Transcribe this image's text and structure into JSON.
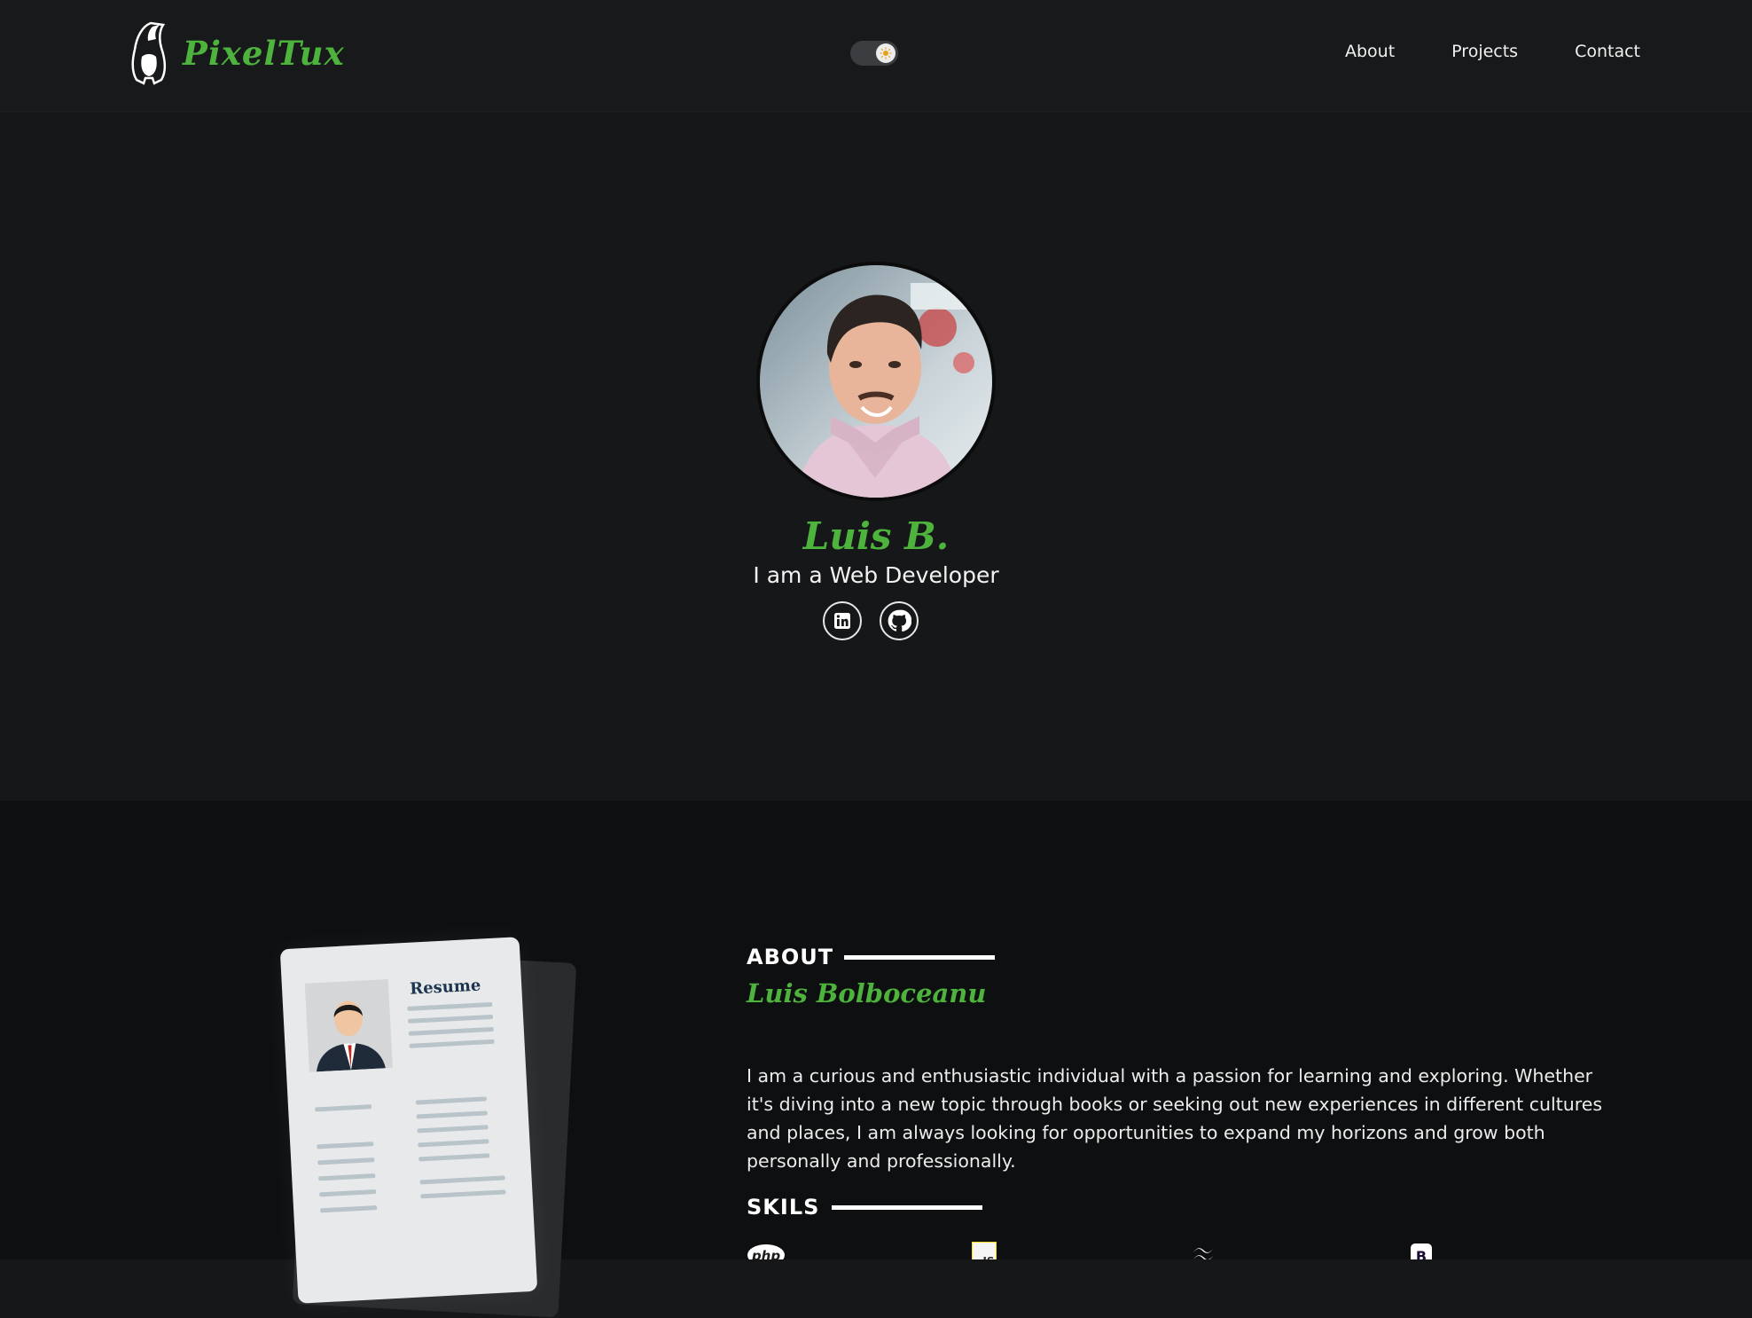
{
  "brand": {
    "name": "PixelTux",
    "color": "#4db33d"
  },
  "theme_toggle": {
    "state": "light-icon",
    "icon": "sun-icon"
  },
  "nav": {
    "items": [
      {
        "label": "About"
      },
      {
        "label": "Projects"
      },
      {
        "label": "Contact"
      }
    ]
  },
  "hero": {
    "name": "Luis B.",
    "role": "I am a Web Developer",
    "socials": [
      {
        "icon": "linkedin-icon"
      },
      {
        "icon": "github-icon"
      }
    ]
  },
  "about": {
    "heading": "ABOUT",
    "name": "Luis Bolboceanu",
    "text": "I am a curious and enthusiastic individual with a passion for learning and exploring. Whether it's diving into a new topic through books or seeking out new experiences in different cultures and places, I am always looking for opportunities to expand my horizons and grow both personally and professionally.",
    "resume_label": "Resume"
  },
  "skills": {
    "heading": "SKILS",
    "items": [
      {
        "icon": "php-icon",
        "label": "php"
      },
      {
        "icon": "javascript-icon",
        "label": "JS"
      },
      {
        "icon": "tailwind-icon"
      },
      {
        "icon": "bootstrap-icon",
        "label": "B"
      }
    ]
  }
}
